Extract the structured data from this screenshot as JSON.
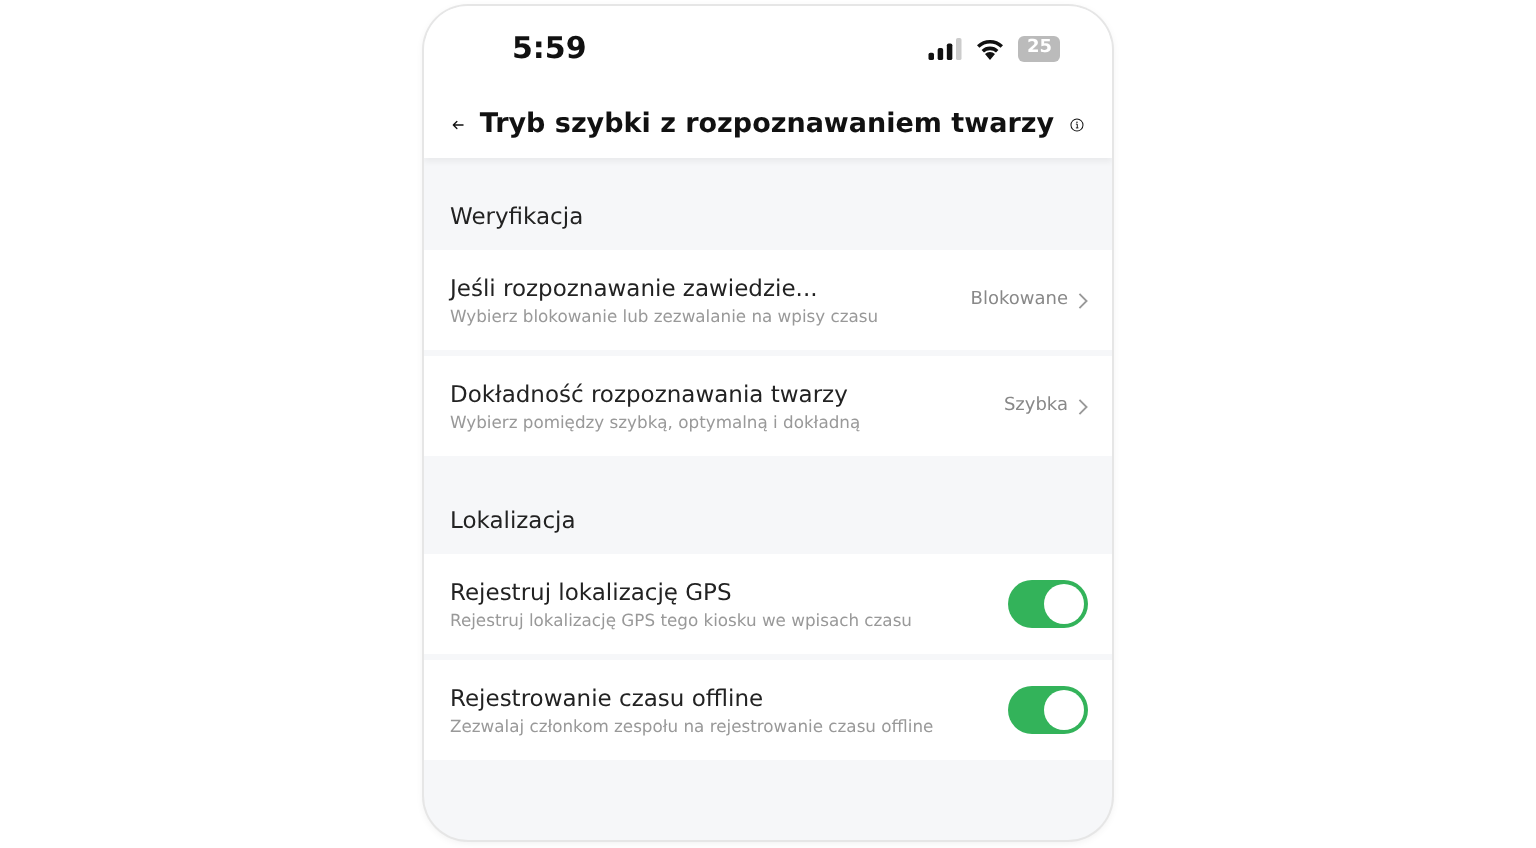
{
  "status_bar": {
    "time": "5:59",
    "battery": "25"
  },
  "header": {
    "title": "Tryb szybki z rozpoznawaniem twarzy"
  },
  "sections": [
    {
      "title": "Weryfikacja",
      "rows": [
        {
          "kind": "link",
          "title": "Jeśli rozpoznawanie zawiedzie...",
          "subtitle": "Wybierz blokowanie lub zezwalanie na wpisy czasu",
          "value": "Blokowane"
        },
        {
          "kind": "link",
          "title": "Dokładność rozpoznawania twarzy",
          "subtitle": "Wybierz pomiędzy szybką, optymalną i dokładną",
          "value": "Szybka"
        }
      ]
    },
    {
      "title": "Lokalizacja",
      "rows": [
        {
          "kind": "toggle",
          "title": "Rejestruj lokalizację GPS",
          "subtitle": "Rejestruj lokalizację GPS tego kiosku we wpisach czasu",
          "on": true
        },
        {
          "kind": "toggle",
          "title": "Rejestrowanie czasu offline",
          "subtitle": "Zezwalaj członkom zespołu na rejestrowanie czasu offline",
          "on": true
        }
      ]
    }
  ]
}
